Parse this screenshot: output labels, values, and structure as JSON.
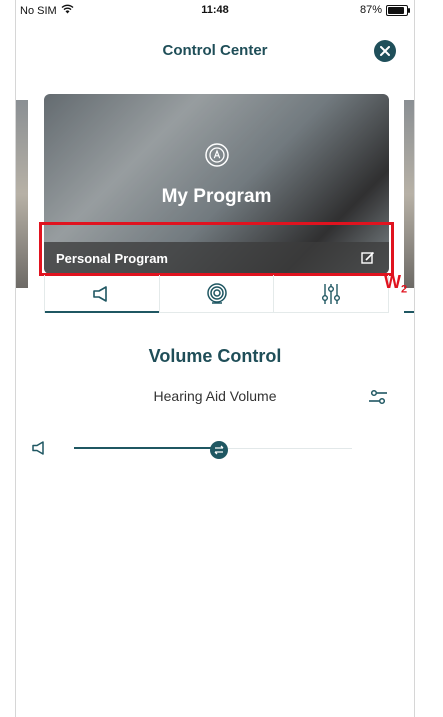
{
  "status": {
    "carrier": "No SIM",
    "time": "11:48",
    "battery": "87%",
    "battery_level": 0.87
  },
  "header": {
    "title": "Control Center"
  },
  "program": {
    "name": "My Program",
    "bar_label": "Personal Program"
  },
  "annotation": {
    "label": "W",
    "subscript": "2"
  },
  "tabs": [
    {
      "icon": "speaker-icon",
      "active": true
    },
    {
      "icon": "radar-icon",
      "active": false
    },
    {
      "icon": "equalizer-icon",
      "active": false
    }
  ],
  "volume": {
    "title": "Volume Control",
    "subtitle": "Hearing Aid Volume",
    "level": 0.52
  },
  "colors": {
    "accent": "#1f5762",
    "highlight": "#e0131f"
  }
}
